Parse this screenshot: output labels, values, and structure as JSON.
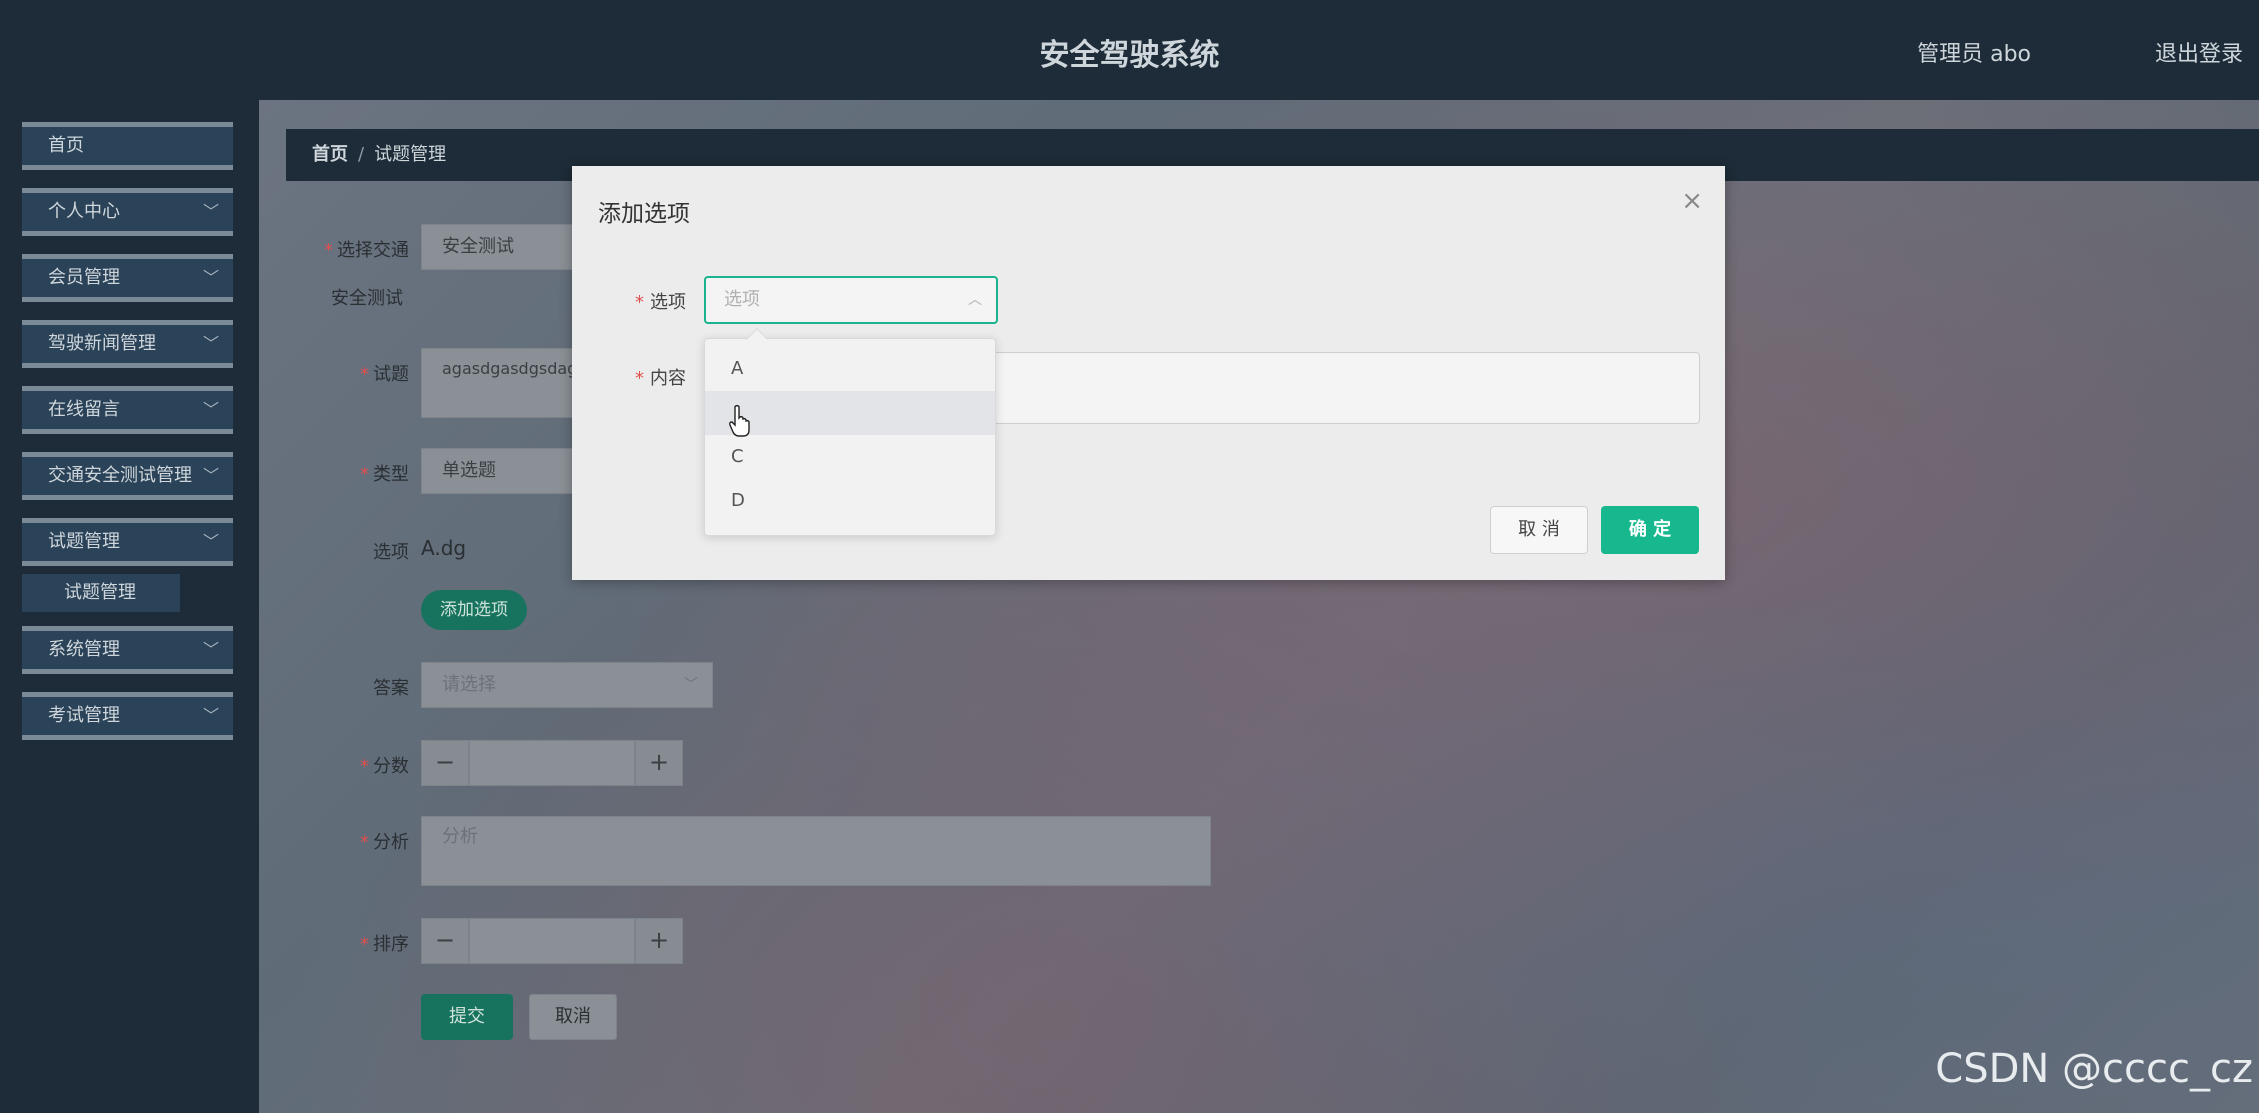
{
  "header": {
    "title": "安全驾驶系统",
    "user": "管理员 abo",
    "logout": "退出登录"
  },
  "sidebar": {
    "items": [
      {
        "label": "首页",
        "has_chevron": false
      },
      {
        "label": "个人中心",
        "has_chevron": true
      },
      {
        "label": "会员管理",
        "has_chevron": true
      },
      {
        "label": "驾驶新闻管理",
        "has_chevron": true
      },
      {
        "label": "在线留言",
        "has_chevron": true
      },
      {
        "label": "交通安全测试管理",
        "has_chevron": true
      },
      {
        "label": "试题管理",
        "has_chevron": true
      },
      {
        "label": "系统管理",
        "has_chevron": true
      },
      {
        "label": "考试管理",
        "has_chevron": true
      }
    ],
    "sub_item": "试题管理"
  },
  "breadcrumb": {
    "home": "首页",
    "separator": "/",
    "current": "试题管理"
  },
  "form": {
    "traffic_label": "选择交通",
    "traffic_value": "安全测试",
    "traffic_sub": "安全测试",
    "question_label": "试题",
    "question_value": "agasdgasdgsdag",
    "type_label": "类型",
    "type_value": "单选题",
    "options_label": "选项",
    "options_value": "A.dg",
    "add_option_button": "添加选项",
    "answer_label": "答案",
    "answer_placeholder": "请选择",
    "score_label": "分数",
    "analysis_label": "分析",
    "analysis_placeholder": "分析",
    "sort_label": "排序",
    "stepper_minus": "−",
    "stepper_plus": "+",
    "submit_button": "提交",
    "cancel_button": "取消"
  },
  "dialog": {
    "title": "添加选项",
    "option_label": "选项",
    "option_placeholder": "选项",
    "content_label": "内容",
    "cancel_button": "取 消",
    "confirm_button": "确 定",
    "close_icon": "close-icon"
  },
  "dropdown": {
    "options": [
      "A",
      "",
      "C",
      "D"
    ],
    "hovered_index": 1
  },
  "watermark": "CSDN @cccc_cz",
  "colors": {
    "accent": "#18b88f",
    "sidebar_bg": "#1d2c38",
    "required": "#e04f4f"
  }
}
